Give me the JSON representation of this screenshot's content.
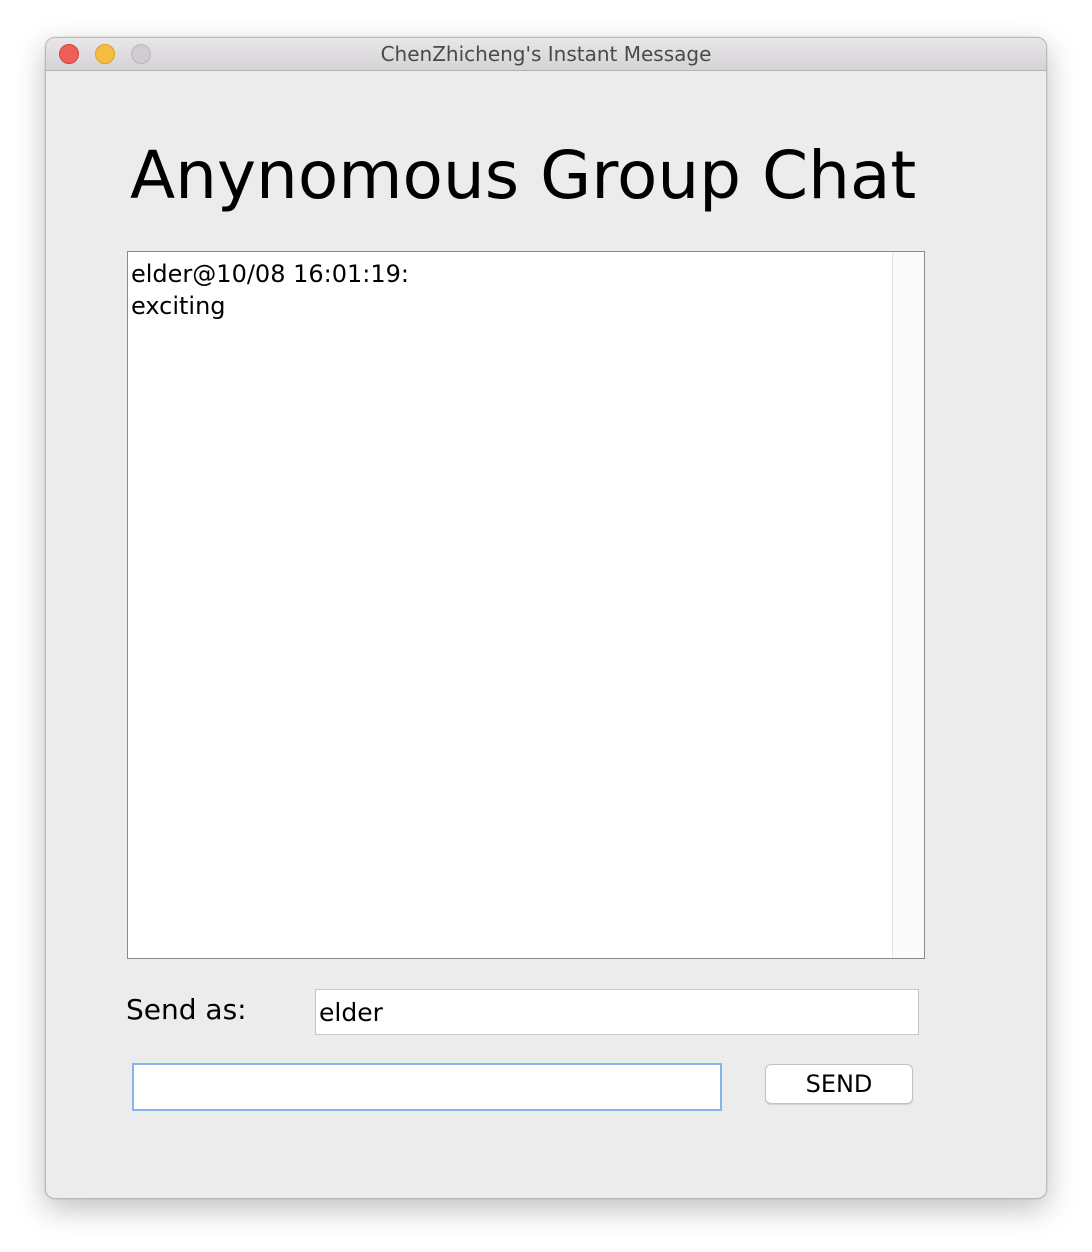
{
  "window": {
    "title": "ChenZhicheng's Instant Message"
  },
  "main": {
    "heading": "Anynomous Group Chat",
    "messages": [
      {
        "header": "elder@10/08 16:01:19:",
        "body": "exciting"
      }
    ]
  },
  "form": {
    "send_as_label": "Send as:",
    "name_value": "elder",
    "message_value": "",
    "send_label": "SEND"
  },
  "colors": {
    "close": "#ee5f57",
    "minimize": "#f6be41",
    "maximize": "#cfcdcf",
    "focus_ring": "#87b4ec"
  },
  "icons": [
    "close-icon",
    "minimize-icon",
    "maximize-icon"
  ]
}
